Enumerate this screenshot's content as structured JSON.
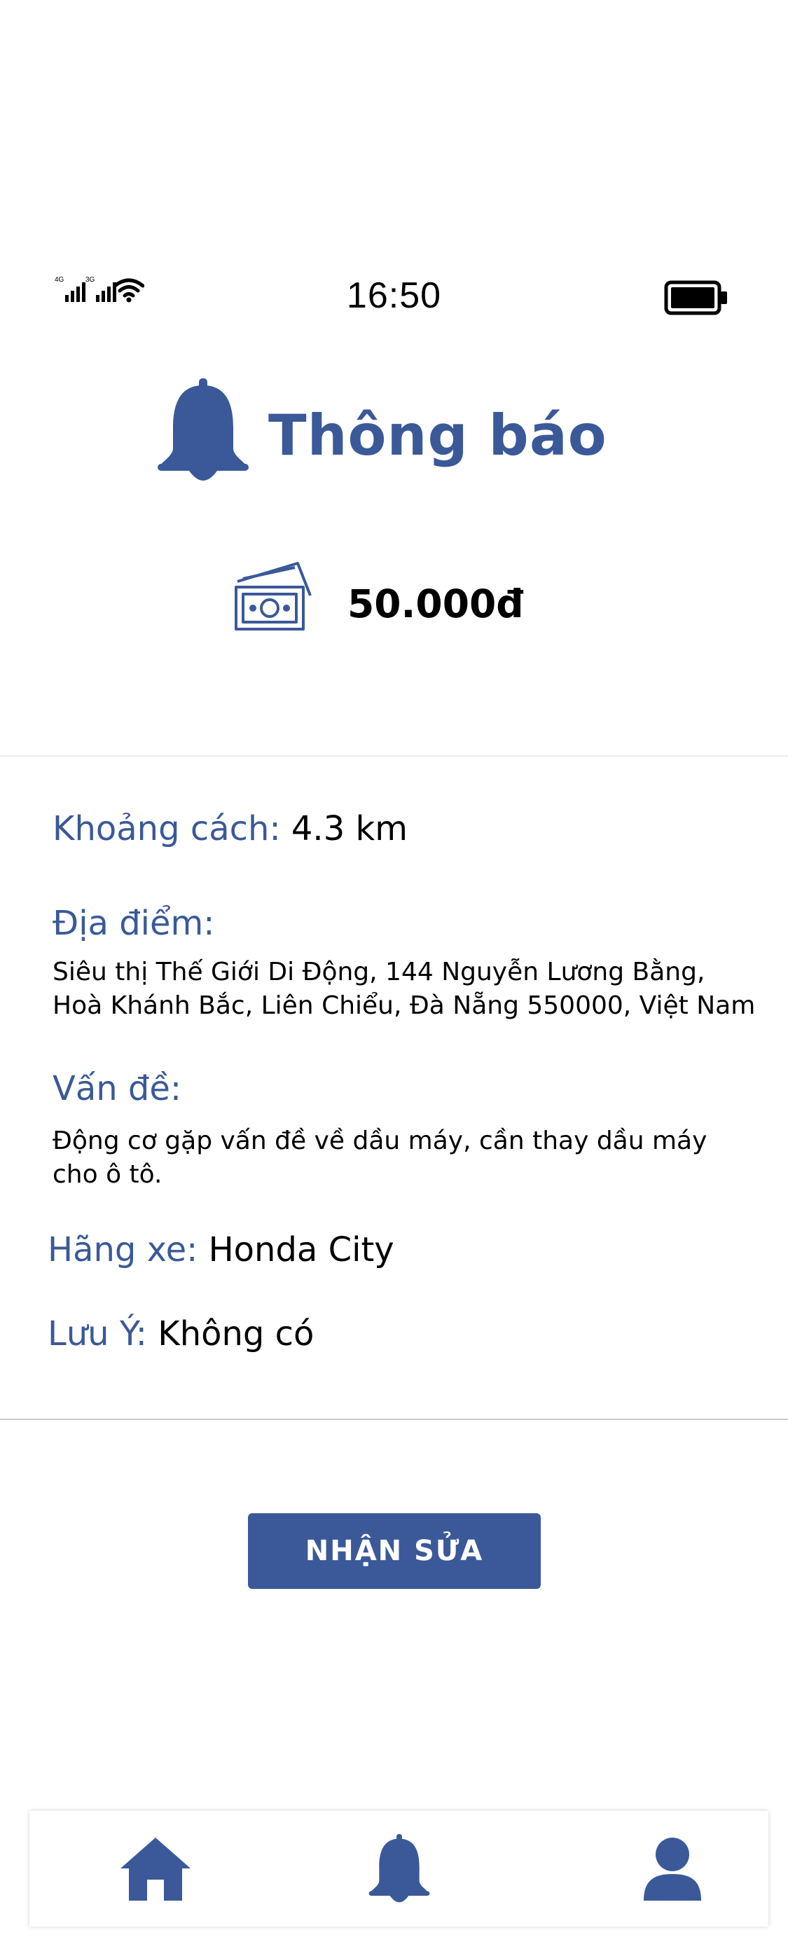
{
  "status_bar": {
    "network_1": "4G",
    "network_2": "3G",
    "time": "16:50",
    "icons": [
      "signal-icon",
      "signal-icon",
      "wifi-icon",
      "battery-icon"
    ]
  },
  "header": {
    "title": "Thông báo",
    "icon": "bell-icon"
  },
  "price": {
    "icon": "money-icon",
    "amount": "50.000đ"
  },
  "details": {
    "distance_label": "Khoảng cách:",
    "distance_value": "4.3 km",
    "location_label": "Địa điểm:",
    "location_line_1": "Siêu thị Thế Giới Di Động, 144 Nguyễn Lương Bằng,",
    "location_line_2": "Hoà Khánh Bắc, Liên Chiểu, Đà Nẵng 550000, Việt Nam",
    "problem_label": "Vấn đề:",
    "problem_line_1": "Động cơ gặp vấn đề về dầu máy, cần thay dầu máy",
    "problem_line_2": "cho ô tô.",
    "brand_label": "Hãng xe:",
    "brand_value": "Honda City",
    "note_label": "Lưu Ý:",
    "note_value": "Không có"
  },
  "actions": {
    "accept_label": "NHẬN SỬA"
  },
  "tabbar": {
    "items": [
      "home-icon",
      "bell-icon",
      "user-icon"
    ]
  },
  "colors": {
    "accent": "#3b5998",
    "text": "#000000",
    "divider": "#c8c8c8"
  }
}
